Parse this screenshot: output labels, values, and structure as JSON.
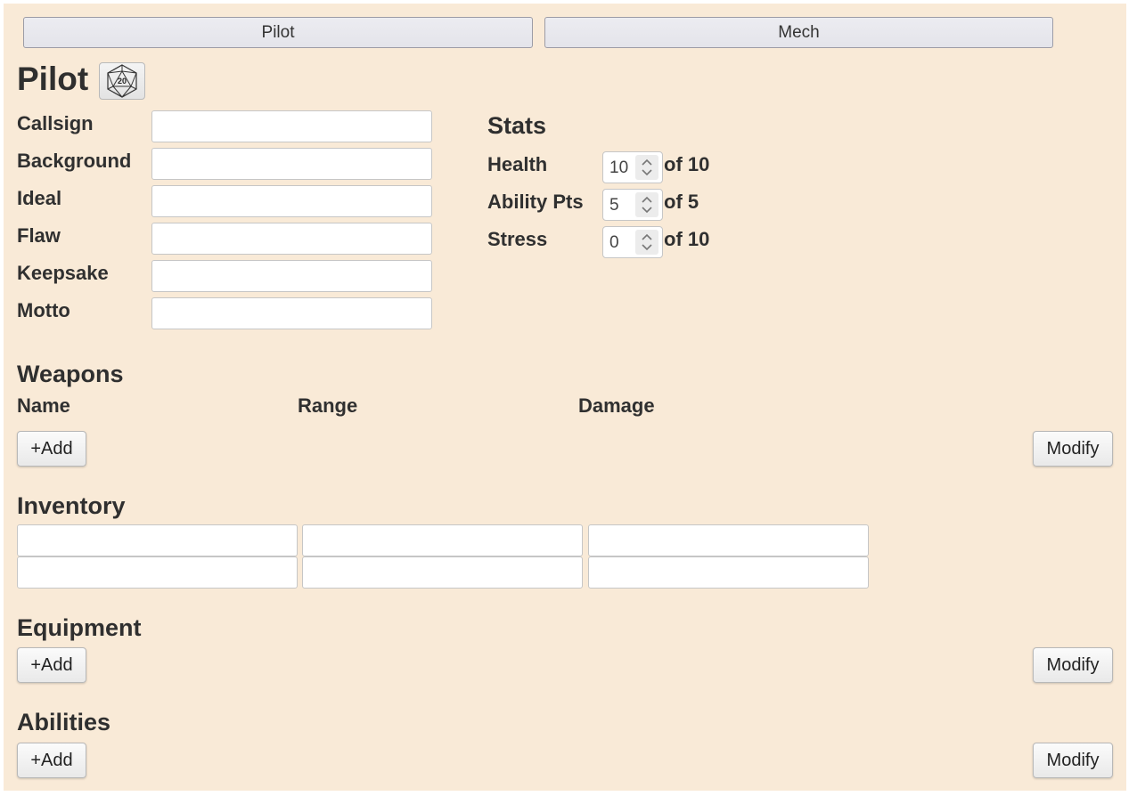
{
  "tabs": [
    {
      "label": "Pilot"
    },
    {
      "label": "Mech"
    }
  ],
  "page": {
    "title": "Pilot"
  },
  "dice": {
    "label": "20"
  },
  "identity": [
    {
      "label": "Callsign",
      "value": ""
    },
    {
      "label": "Background",
      "value": ""
    },
    {
      "label": "Ideal",
      "value": ""
    },
    {
      "label": "Flaw",
      "value": ""
    },
    {
      "label": "Keepsake",
      "value": ""
    },
    {
      "label": "Motto",
      "value": ""
    }
  ],
  "stats": {
    "heading": "Stats",
    "rows": [
      {
        "label": "Health",
        "value": "10",
        "max": "of 10"
      },
      {
        "label": "Ability Pts",
        "value": "5",
        "max": "of 5"
      },
      {
        "label": "Stress",
        "value": "0",
        "max": "of 10"
      }
    ]
  },
  "weapons": {
    "heading": "Weapons",
    "columns": [
      "Name",
      "Range",
      "Damage"
    ],
    "add_label": "+Add",
    "modify_label": "Modify"
  },
  "inventory": {
    "heading": "Inventory",
    "slots": [
      [
        "",
        "",
        ""
      ],
      [
        "",
        "",
        ""
      ]
    ]
  },
  "equipment": {
    "heading": "Equipment",
    "add_label": "+Add",
    "modify_label": "Modify"
  },
  "abilities": {
    "heading": "Abilities",
    "add_label": "+Add",
    "modify_label": "Modify"
  },
  "colors": {
    "background": "#f9ead7",
    "tab_bg": "#e6e6ec"
  }
}
